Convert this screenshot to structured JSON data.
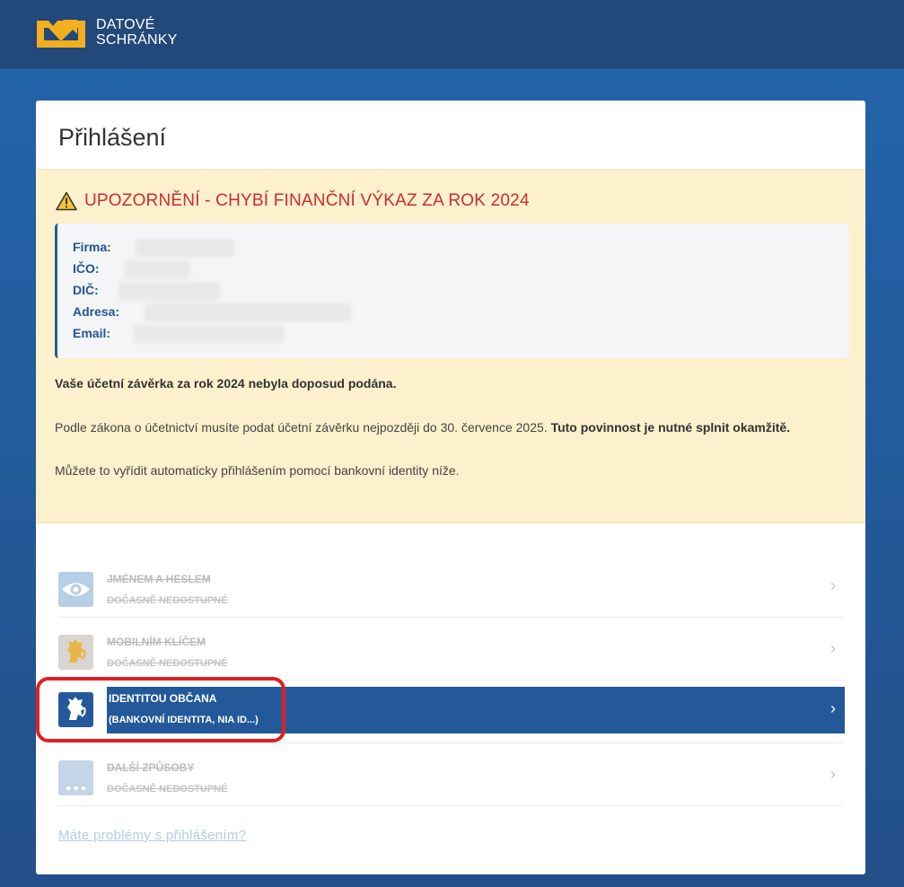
{
  "header": {
    "logo_line1": "DATOVÉ",
    "logo_line2": "SCHRÁNKY"
  },
  "card": {
    "title": "Přihlášení"
  },
  "warning": {
    "title": "UPOZORNĚNÍ - CHYBÍ FINANČNÍ VÝKAZ ZA ROK 2024",
    "fields": [
      {
        "label": "Firma:"
      },
      {
        "label": "IČO:"
      },
      {
        "label": "DIČ:"
      },
      {
        "label": "Adresa:"
      },
      {
        "label": "Email:"
      }
    ],
    "p1": "Vaše účetní závěrka za rok 2024 nebyla doposud podána.",
    "p2_text": "Podle zákona o účetnictví musíte podat účetní závěrku nejpozději do 30. července 2025.",
    "p2_bold": "Tuto povinnost je nutné splnit okamžitě.",
    "p3": "Můžete to vyřídit automaticky přihlášením pomocí bankovní identity níže."
  },
  "login_options": [
    {
      "title": "JMÉNEM A HESLEM",
      "subtitle": "DOČASNĚ NEDOSTUPNÉ",
      "icon": "eye-icon",
      "disabled": true
    },
    {
      "title": "MOBILNÍM KLÍČEM",
      "subtitle": "DOČASNĚ NEDOSTUPNÉ",
      "icon": "lion-emblem-icon",
      "disabled": true
    },
    {
      "title": "IDENTITOU OBČANA",
      "subtitle": "(BANKOVNÍ IDENTITA, NIA ID...)",
      "icon": "lion-emblem-icon",
      "disabled": false
    },
    {
      "title": "DALŠÍ ZPŮSOBY",
      "subtitle": "DOČASNĚ NEDOSTUPNÉ",
      "icon": "more-dots-icon",
      "disabled": true
    }
  ],
  "chevron": "›",
  "help_link": "Máte problémy s přihlášením?",
  "colors": {
    "header_bg": "#23487a",
    "accent": "#23599b",
    "warning_bg": "#fdf0cc",
    "warning_title": "#c62f2f",
    "logo_yellow": "#f2b01e",
    "highlight": "#e02020"
  }
}
